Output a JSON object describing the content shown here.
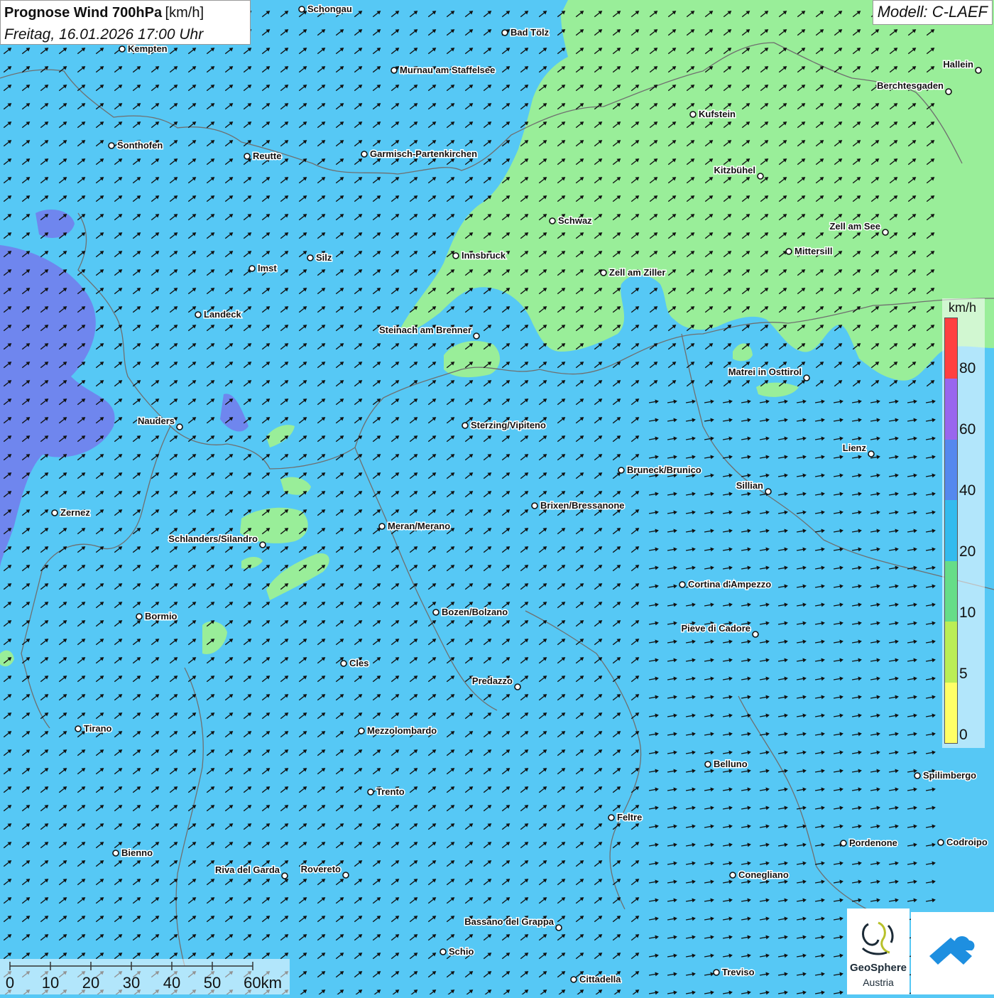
{
  "header": {
    "title": "Prognose Wind 700hPa",
    "unit": "[km/h]",
    "datetime": "Freitag, 16.01.2026 17:00 Uhr"
  },
  "model": "Modell: C-LAEF",
  "legend": {
    "unit": "km/h",
    "ticks": [
      "80",
      "60",
      "40",
      "20",
      "10",
      "5",
      "0"
    ],
    "colors": [
      "#ff4040",
      "#9966ee",
      "#5588ee",
      "#33bbee",
      "#66dd88",
      "#bbee55",
      "#ffff66"
    ]
  },
  "scale": {
    "labels": [
      "0",
      "10",
      "20",
      "30",
      "40",
      "50",
      "60km"
    ]
  },
  "logo": {
    "name": "GeoSphere",
    "sub": "Austria"
  },
  "colors": {
    "sea_blue": "#56c8f5",
    "calm_green": "#99ee99",
    "strong_purple": "#6677ee",
    "border": "#6f6f6f",
    "arrow": "#111111"
  },
  "wind_arrow_direction": "north-east",
  "cities": [
    {
      "name": "Schongau"
    },
    {
      "name": "Bad Tölz"
    },
    {
      "name": "Kempten"
    },
    {
      "name": "Murnau am Staffelsee"
    },
    {
      "name": "Hallein"
    },
    {
      "name": "Berchtesgaden"
    },
    {
      "name": "Kufstein"
    },
    {
      "name": "Sonthofen"
    },
    {
      "name": "Reutte"
    },
    {
      "name": "Garmisch-Partenkirchen"
    },
    {
      "name": "Kitzbühel"
    },
    {
      "name": "Schwaz"
    },
    {
      "name": "Zell am See"
    },
    {
      "name": "Mittersill"
    },
    {
      "name": "Innsbruck"
    },
    {
      "name": "Imst"
    },
    {
      "name": "Silz"
    },
    {
      "name": "Zell am Ziller"
    },
    {
      "name": "Landeck"
    },
    {
      "name": "Steinach am Brenner"
    },
    {
      "name": "Matrei in Osttirol"
    },
    {
      "name": "Nauders"
    },
    {
      "name": "Sterzing/Vipiteno"
    },
    {
      "name": "Lienz"
    },
    {
      "name": "Bruneck/Brunico"
    },
    {
      "name": "Sillian"
    },
    {
      "name": "Zernez"
    },
    {
      "name": "Brixen/Bressanone"
    },
    {
      "name": "Meran/Merano"
    },
    {
      "name": "Schlanders/Silandro"
    },
    {
      "name": "Cortina d'Ampezzo"
    },
    {
      "name": "Bormio"
    },
    {
      "name": "Bozen/Bolzano"
    },
    {
      "name": "Pieve di Cadore"
    },
    {
      "name": "Cles"
    },
    {
      "name": "Predazzo"
    },
    {
      "name": "Tirano"
    },
    {
      "name": "Mezzolombardo"
    },
    {
      "name": "Belluno"
    },
    {
      "name": "Spilimbergo"
    },
    {
      "name": "Trento"
    },
    {
      "name": "Feltre"
    },
    {
      "name": "Pordenone"
    },
    {
      "name": "Codroipo"
    },
    {
      "name": "Bienno"
    },
    {
      "name": "Riva del Garda"
    },
    {
      "name": "Rovereto"
    },
    {
      "name": "Conegliano"
    },
    {
      "name": "Bassano del Grappa"
    },
    {
      "name": "Schio"
    },
    {
      "name": "Treviso"
    },
    {
      "name": "Cittadella"
    }
  ]
}
